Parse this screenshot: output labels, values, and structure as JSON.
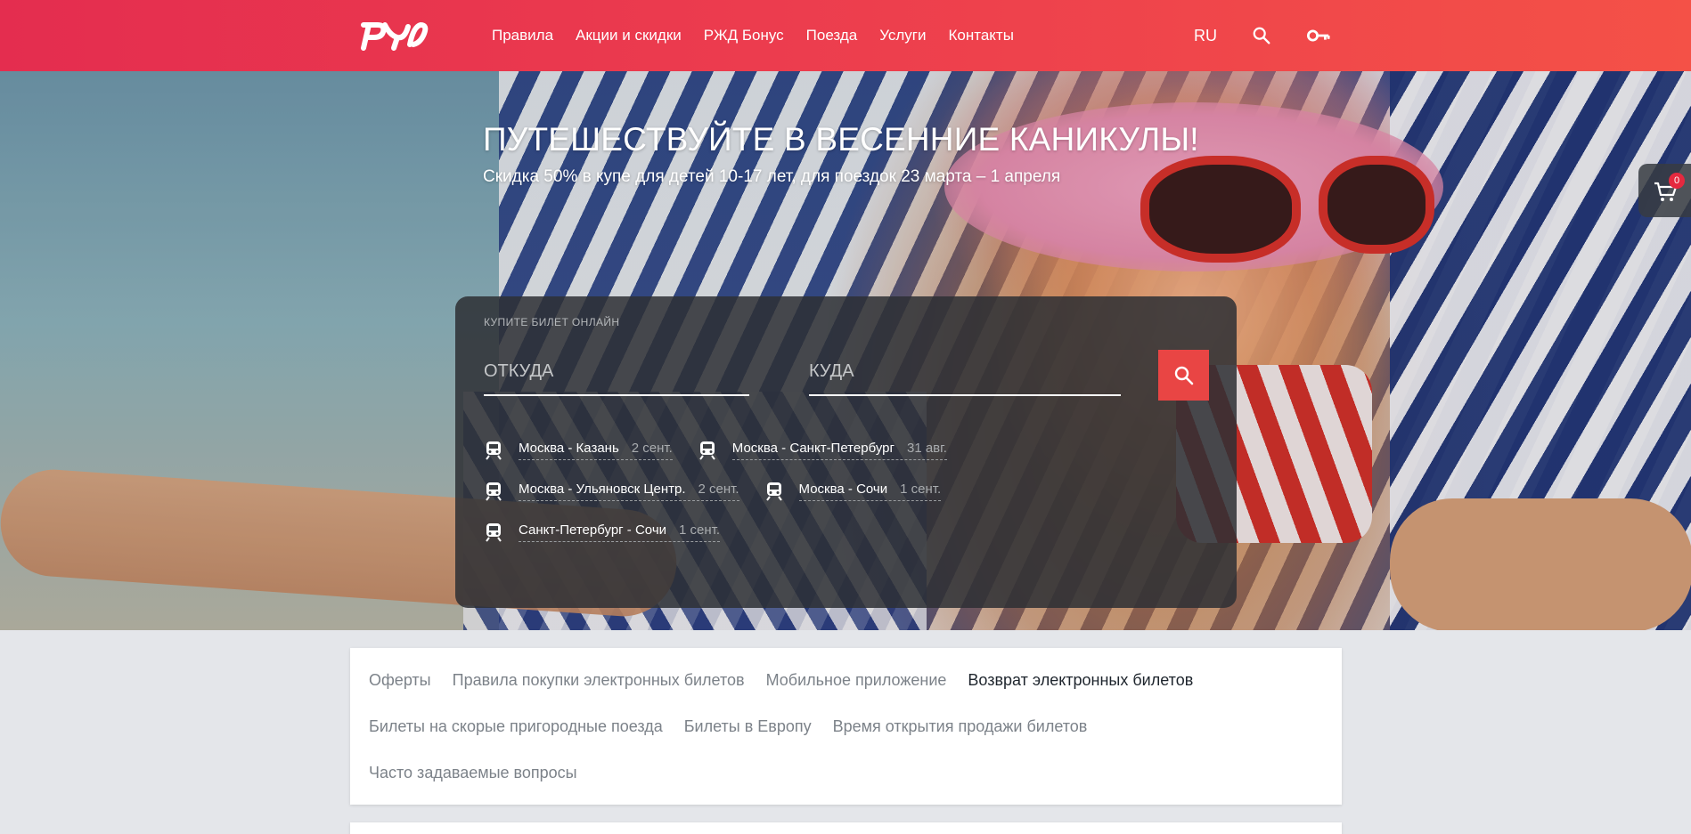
{
  "header": {
    "logo": "РЖД",
    "nav": [
      "Правила",
      "Акции и скидки",
      "РЖД Бонус",
      "Поезда",
      "Услуги",
      "Контакты"
    ],
    "language": "RU",
    "search_icon": "search-icon",
    "account_icon": "key-icon"
  },
  "promo": {
    "title": "ПУТЕШЕСТВУЙТЕ В ВЕСЕННИЕ КАНИКУЛЫ!",
    "subtitle": "Скидка 50% в купе для детей 10-17 лет, для поездок 23 марта – 1 апреля"
  },
  "cart": {
    "icon": "cart-icon",
    "count": "0"
  },
  "booking": {
    "label": "КУПИТЕ БИЛЕТ ОНЛАЙН",
    "from_placeholder": "ОТКУДА",
    "to_placeholder": "КУДА",
    "from_value": "",
    "to_value": "",
    "search_icon": "search-icon",
    "recent": [
      [
        {
          "route": "Москва - Казань",
          "date": "2 сент."
        },
        {
          "route": "Москва - Санкт-Петербург",
          "date": "31 авг."
        }
      ],
      [
        {
          "route": "Москва - Ульяновск Центр.",
          "date": "2 сент."
        },
        {
          "route": "Москва - Сочи",
          "date": "1 сент."
        }
      ],
      [
        {
          "route": "Санкт-Петербург - Сочи",
          "date": "1 сент."
        }
      ]
    ]
  },
  "info_links": {
    "row1": [
      "Оферты",
      "Правила покупки электронных билетов",
      "Мобильное приложение",
      "Возврат электронных билетов"
    ],
    "row2": [
      "Билеты на скорые пригородные поезда",
      "Билеты в Европу",
      "Время открытия продажи билетов"
    ],
    "row3": [
      "Часто задаваемые вопросы"
    ],
    "active": "Возврат электронных билетов"
  },
  "colors": {
    "header_start": "#e42d4f",
    "header_end": "#f45147",
    "accent": "#e94544",
    "panel_bg": "#2d3034",
    "page_bg": "#e4e6ea"
  }
}
